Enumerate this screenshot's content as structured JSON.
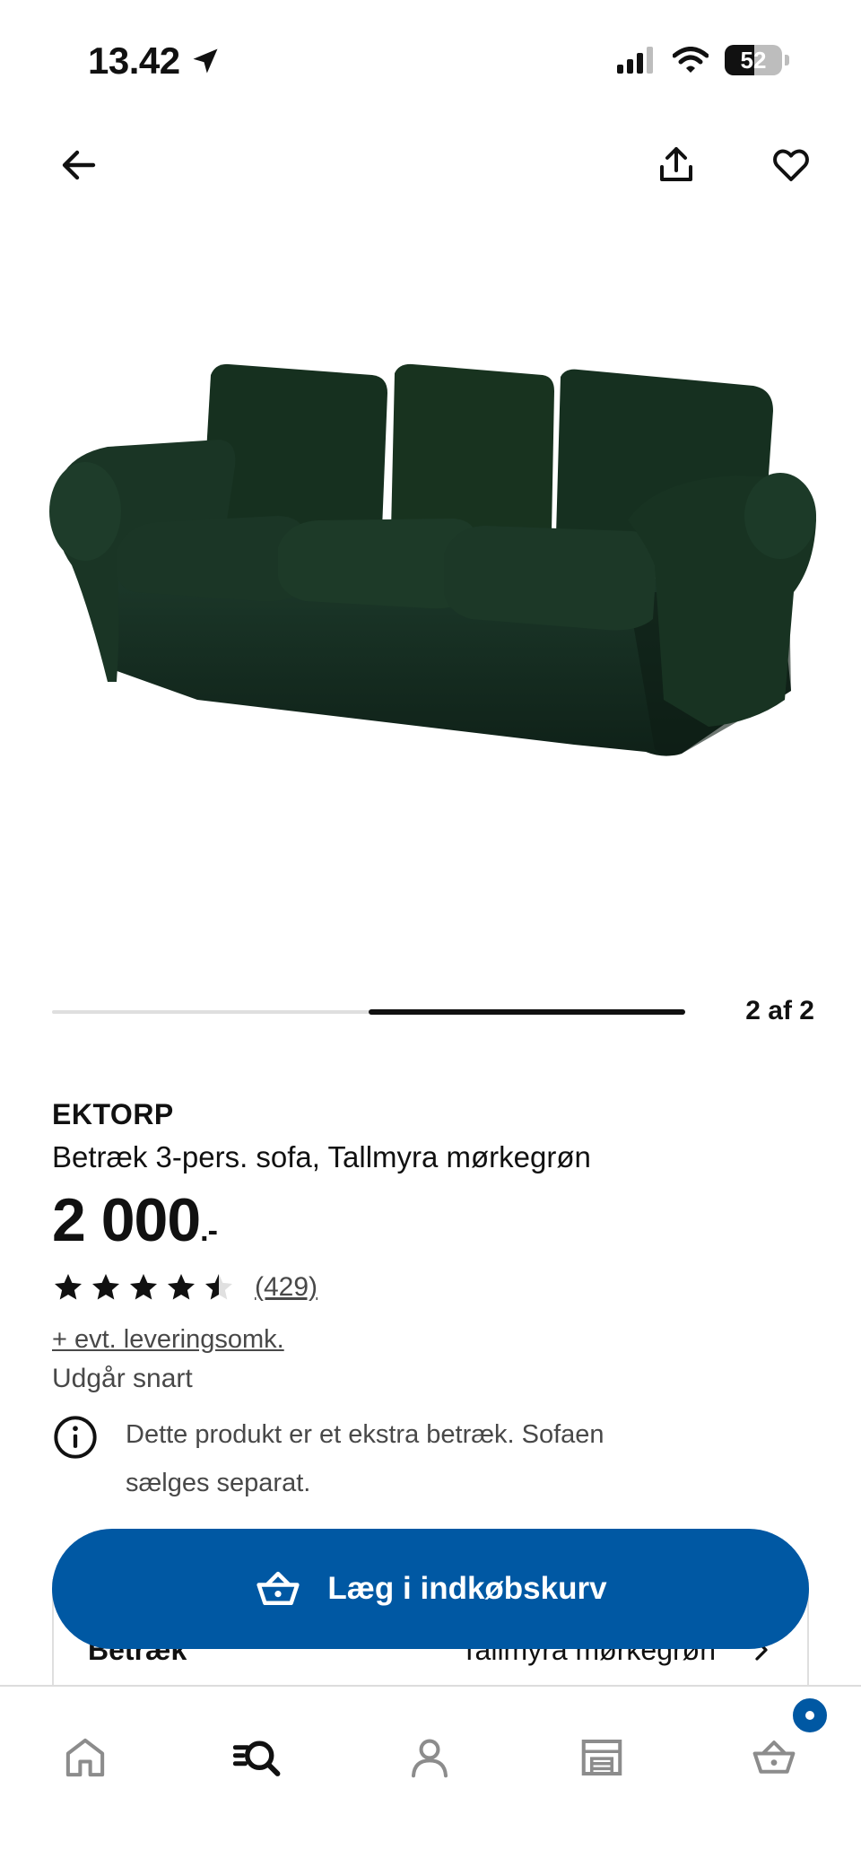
{
  "status_bar": {
    "time": "13.42",
    "battery_level": "52",
    "battery_fraction": 0.52
  },
  "top_nav": {
    "back_icon": "arrow-left-icon",
    "share_icon": "share-icon",
    "favorite_icon": "heart-icon"
  },
  "carousel": {
    "page_label": "2 af 2",
    "current_page": 2,
    "total_pages": 2
  },
  "product": {
    "name": "EKTORP",
    "description": "Betræk 3-pers. sofa, Tallmyra mørkegrøn",
    "price": "2 000",
    "price_suffix": ".-",
    "rating": 4.5,
    "rating_max": 5,
    "review_count": "(429)",
    "delivery_link": "+ evt. leveringsomk.",
    "stock_status": "Udgår snart",
    "notice": "Dette produkt er et ekstra betræk. Sofaen sælges separat."
  },
  "variant": {
    "label": "Betræk",
    "value": "Tallmyra mørkegrøn"
  },
  "add_to_cart": {
    "label": "Læg i indkøbskurv"
  },
  "tab_bar": {
    "items": [
      "home-icon",
      "search-icon",
      "profile-icon",
      "store-icon",
      "cart-icon"
    ],
    "cart_badge": true
  },
  "colors": {
    "primary_blue": "#0058a3",
    "sofa_green": "#13271c",
    "text": "#111111",
    "secondary_text": "#484848"
  }
}
